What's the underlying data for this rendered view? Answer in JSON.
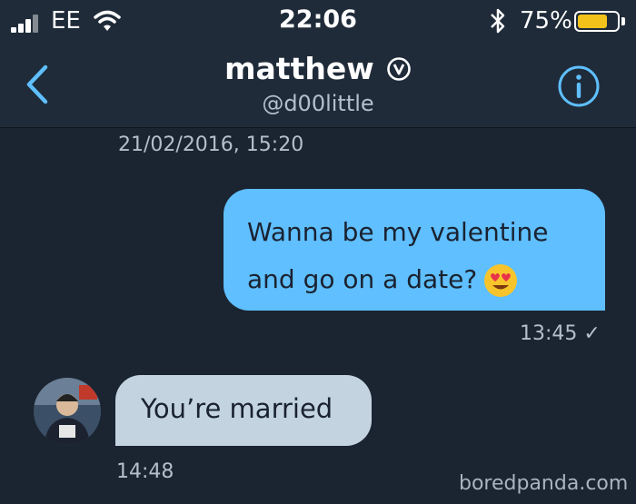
{
  "status_bar": {
    "carrier": "EE",
    "time": "22:06",
    "battery_percent": "75%",
    "battery_level": 0.75,
    "battery_color": "#f3c21a",
    "icons": [
      "signal-icon",
      "wifi-icon",
      "bluetooth-icon",
      "battery-icon"
    ]
  },
  "header": {
    "contact_name": "matthew",
    "handle": "@d00little",
    "back_icon": "chevron-left-icon",
    "info_icon": "info-icon",
    "verified_icon": "verified-v-icon"
  },
  "conversation": {
    "date_stamp": "21/02/2016, 15:20",
    "messages": [
      {
        "direction": "sent",
        "lines": [
          "Wanna be my valentine",
          "and go on a date?"
        ],
        "emoji": "heart-eyes-emoji",
        "time": "13:45",
        "receipt": "✓"
      },
      {
        "direction": "received",
        "text": "You’re married",
        "time": "14:48"
      }
    ]
  },
  "watermark": "boredpanda.com",
  "colors": {
    "background": "#1b2431",
    "header": "#1f2b39",
    "accent": "#5fbfff",
    "received_bubble": "#c3d3e0",
    "meta_text": "#b3c0cc"
  }
}
